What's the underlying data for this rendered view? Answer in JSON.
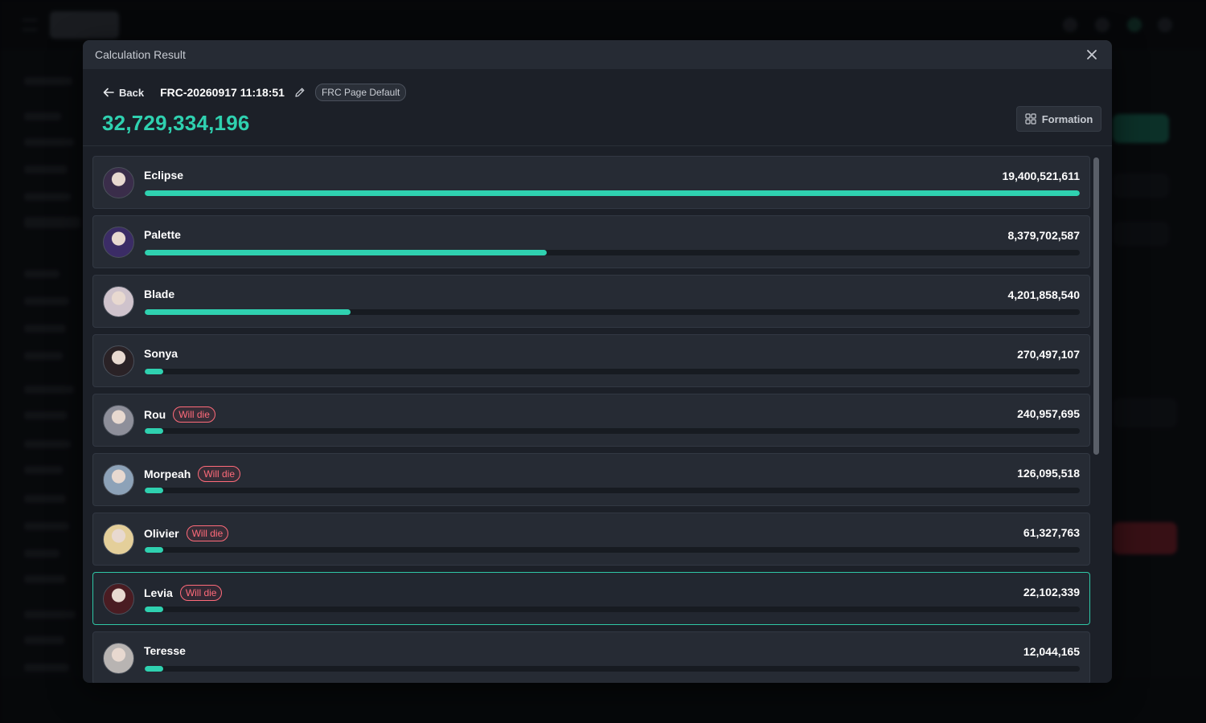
{
  "modal": {
    "title": "Calculation Result"
  },
  "header": {
    "back_label": "Back",
    "calc_name": "FRC-20260917 11:18:51",
    "preset_tag": "FRC Page Default",
    "total": "32,729,334,196",
    "formation_label": "Formation"
  },
  "colors": {
    "accent": "#2fd1b0",
    "danger": "#ff6b7a",
    "selected_border": "#2fc7a6"
  },
  "units": [
    {
      "name": "Eclipse",
      "value": "19,400,521,611",
      "fraction": 1.0,
      "will_die": false,
      "selected": false,
      "avatar_color": "#3a2d4a"
    },
    {
      "name": "Palette",
      "value": "8,379,702,587",
      "fraction": 0.43,
      "will_die": false,
      "selected": false,
      "avatar_color": "#3b2c66"
    },
    {
      "name": "Blade",
      "value": "4,201,858,540",
      "fraction": 0.22,
      "will_die": false,
      "selected": false,
      "avatar_color": "#cfc3cc"
    },
    {
      "name": "Sonya",
      "value": "270,497,107",
      "fraction": 0.02,
      "will_die": false,
      "selected": false,
      "avatar_color": "#2a2226"
    },
    {
      "name": "Rou",
      "value": "240,957,695",
      "fraction": 0.02,
      "will_die": true,
      "selected": false,
      "avatar_color": "#8e8f9a"
    },
    {
      "name": "Morpeah",
      "value": "126,095,518",
      "fraction": 0.02,
      "will_die": true,
      "selected": false,
      "avatar_color": "#8da2b8"
    },
    {
      "name": "Olivier",
      "value": "61,327,763",
      "fraction": 0.02,
      "will_die": true,
      "selected": false,
      "avatar_color": "#e4cf9a"
    },
    {
      "name": "Levia",
      "value": "22,102,339",
      "fraction": 0.02,
      "will_die": true,
      "selected": true,
      "avatar_color": "#4a1c22"
    },
    {
      "name": "Teresse",
      "value": "12,044,165",
      "fraction": 0.02,
      "will_die": false,
      "selected": false,
      "avatar_color": "#b8b4b2"
    }
  ],
  "badge": {
    "will_die_label": "Will die"
  },
  "icons": {
    "close": "close-icon",
    "back": "arrow-left-icon",
    "edit": "pencil-icon",
    "formation": "grid-icon"
  }
}
